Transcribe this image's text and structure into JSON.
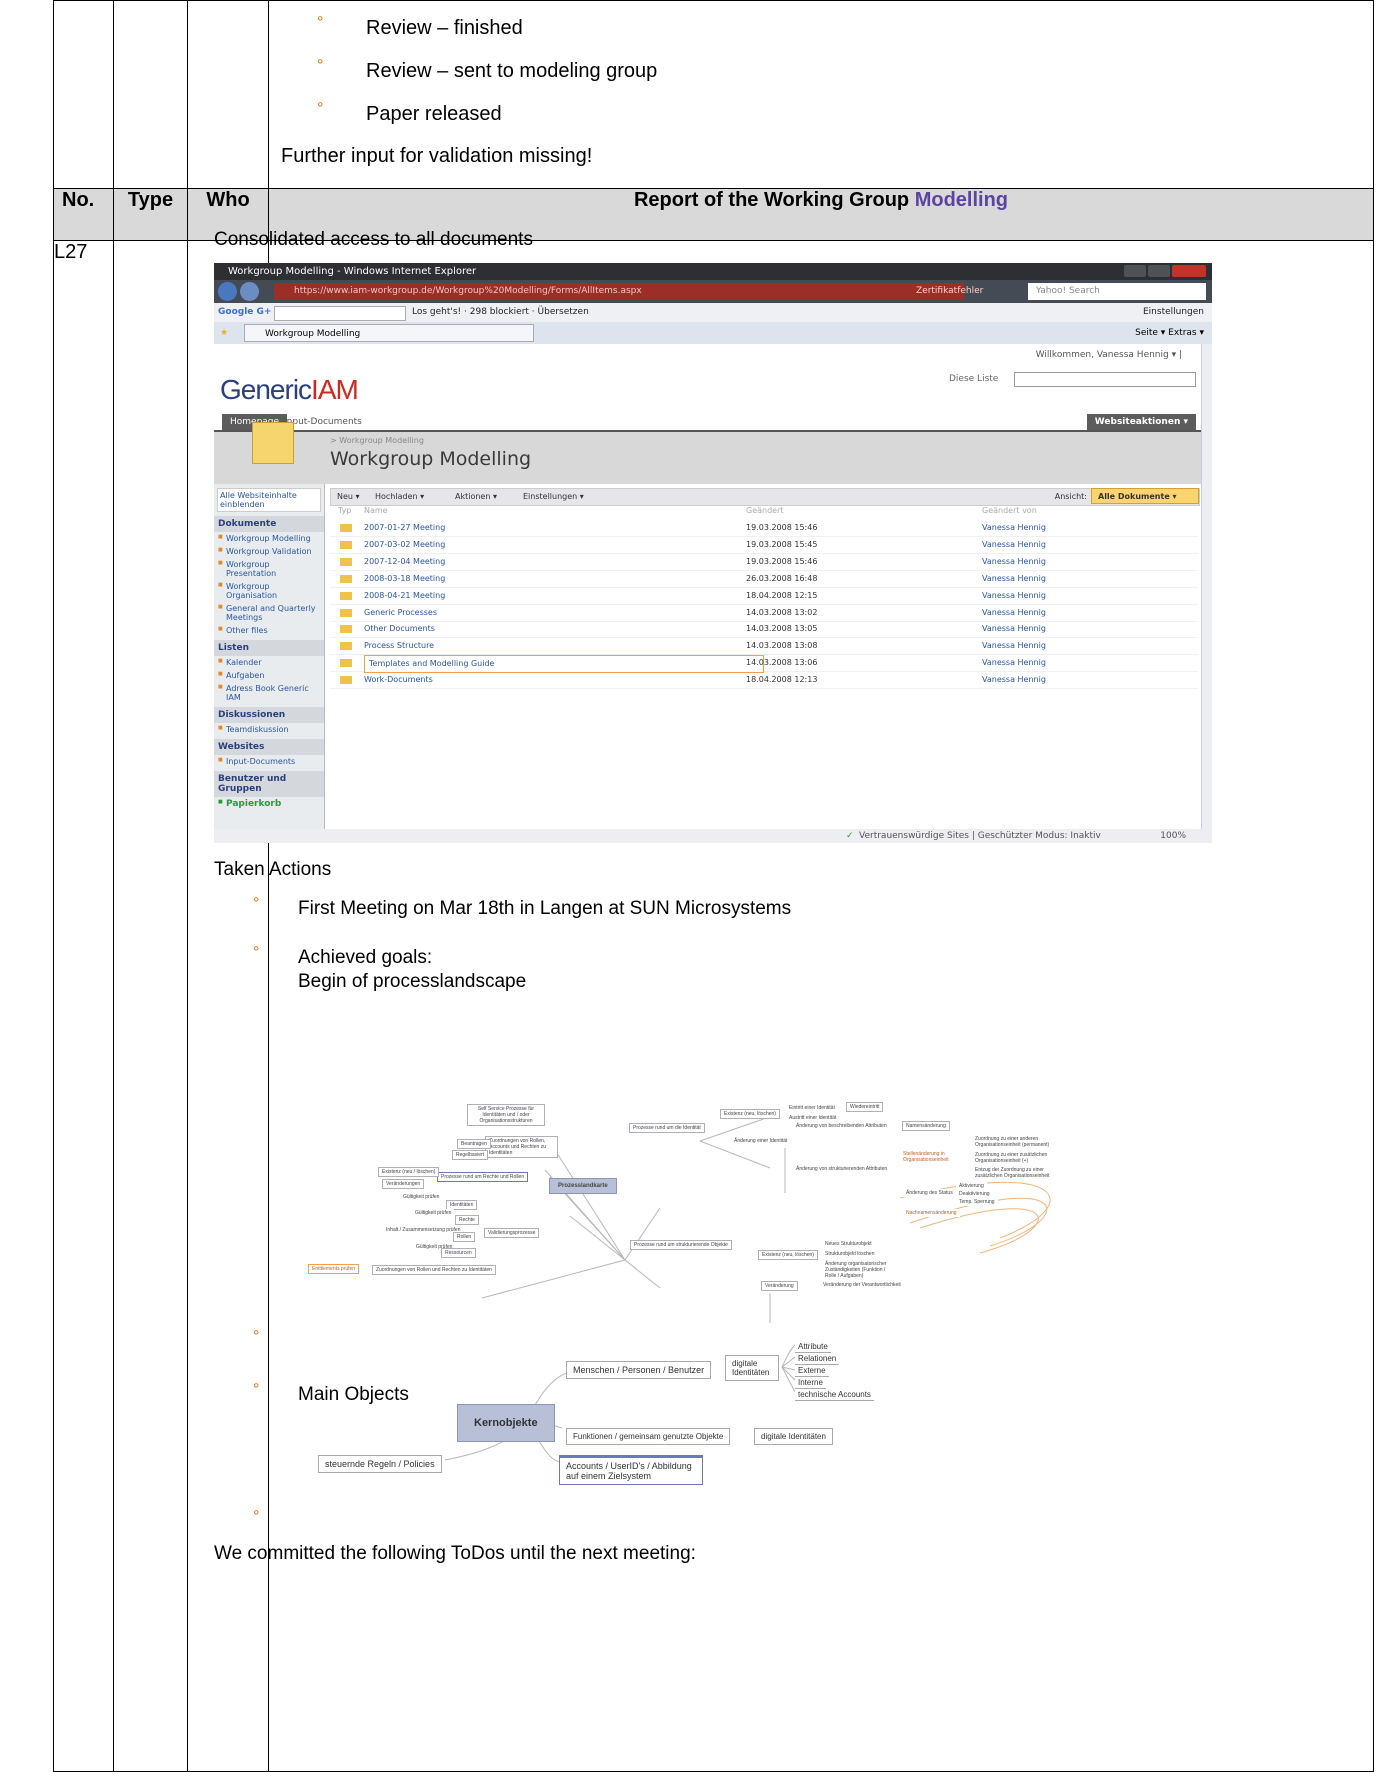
{
  "top_bullets": [
    "Review – finished",
    "Review – sent to modeling group",
    "Paper released"
  ],
  "top_note": "Further input for validation missing!",
  "header": {
    "no": "No.",
    "type": "Type",
    "who": "Who",
    "title_prefix": "Report of the Working Group ",
    "title_accent": "Modelling"
  },
  "accent_color": "#5b44a0",
  "bullet_marker": "°",
  "row": {
    "id": "L27",
    "intro": "Consolidated access to all documents",
    "taken_actions": "Taken Actions",
    "bullets": [
      "First Meeting on Mar 18th in Langen at SUN Microsystems",
      "Achieved goals:",
      "Begin of processlandscape"
    ],
    "main_objects": "Main Objects",
    "todos": "We committed the following ToDos until the next meeting:"
  },
  "browser": {
    "window_title": "Workgroup Modelling - Windows Internet Explorer",
    "url": "https://www.iam-workgroup.de/Workgroup%20Modelling/Forms/AllItems.aspx",
    "cert_warning": "Zertifikatfehler",
    "search_placeholder": "Yahoo! Search",
    "google_label": "Google G+",
    "google_items": "Los geht's! ·  298 blockiert  ·  Übersetzen",
    "settings": "Einstellungen",
    "tab_label": "Workgroup Modelling",
    "tab_tools": "Seite ▾  Extras ▾",
    "welcome": "Willkommen, Vanessa Hennig ▾  |",
    "logo_a": "Generic",
    "logo_b": "IAM",
    "search_scope": "Diese Liste",
    "nav_home": "Homepage",
    "nav_input": "Input-Documents",
    "site_actions": "Websiteaktionen ▾",
    "breadcrumb": "> Workgroup Modelling",
    "page_title": "Workgroup Modelling",
    "left_top": "Alle Websiteinhalte einblenden",
    "left_nav": [
      {
        "heading": "Dokumente",
        "items": [
          "Workgroup Modelling",
          "Workgroup Validation",
          "Workgroup Presentation",
          "Workgroup Organisation",
          "General and Quarterly Meetings",
          "Other files"
        ]
      },
      {
        "heading": "Listen",
        "items": [
          "Kalender",
          "Aufgaben",
          "Adress Book Generic IAM"
        ]
      },
      {
        "heading": "Diskussionen",
        "items": [
          "Teamdiskussion"
        ]
      },
      {
        "heading": "Websites",
        "items": [
          "Input-Documents"
        ]
      },
      {
        "heading": "Benutzer und Gruppen",
        "items": []
      }
    ],
    "papierkorb": "Papierkorb",
    "toolbar": {
      "neu": "Neu ▾",
      "hochladen": "Hochladen ▾",
      "aktionen": "Aktionen ▾",
      "einstellungen": "Einstellungen ▾",
      "ansicht": "Ansicht:",
      "view": "Alle Dokumente ▾"
    },
    "columns": {
      "type": "Typ",
      "name": "Name",
      "modified": "Geändert",
      "modified_by": "Geändert von"
    },
    "files": [
      {
        "name": "2007-01-27 Meeting",
        "modified": "19.03.2008 15:46",
        "by": "Vanessa Hennig"
      },
      {
        "name": "2007-03-02 Meeting",
        "modified": "19.03.2008 15:45",
        "by": "Vanessa Hennig"
      },
      {
        "name": "2007-12-04 Meeting",
        "modified": "19.03.2008 15:46",
        "by": "Vanessa Hennig"
      },
      {
        "name": "2008-03-18 Meeting",
        "modified": "26.03.2008 16:48",
        "by": "Vanessa Hennig"
      },
      {
        "name": "2008-04-21 Meeting",
        "modified": "18.04.2008 12:15",
        "by": "Vanessa Hennig"
      },
      {
        "name": "Generic Processes",
        "modified": "14.03.2008 13:02",
        "by": "Vanessa Hennig"
      },
      {
        "name": "Other Documents",
        "modified": "14.03.2008 13:05",
        "by": "Vanessa Hennig"
      },
      {
        "name": "Process Structure",
        "modified": "14.03.2008 13:08",
        "by": "Vanessa Hennig"
      },
      {
        "name": "Templates and Modelling Guide",
        "modified": "14.03.2008 13:06",
        "by": "Vanessa Hennig"
      },
      {
        "name": "Work-Documents",
        "modified": "18.04.2008 12:13",
        "by": "Vanessa Hennig"
      }
    ],
    "status": "Vertrauenswürdige Sites | Geschützter Modus: Inaktiv",
    "zoom": "100%"
  },
  "mindmap1": {
    "center": "Prozesslandkarte",
    "nodes": [
      "Self Service Prozesse für Identitäten und / oder Organisationsstrukturen",
      "Zuordnungen von Rollen, Accounts und Rechten zu Identitäten",
      "Beantragen",
      "Regelbasiert",
      "Prozesse rund um Rechte und Rollen",
      "Existenz (neu / löschen)",
      "Veränderungen",
      "Validierungsprozesse",
      "Gültigkeit prüfen",
      "Identitäten",
      "Gültigkeit prüfen",
      "Rechte",
      "Inhalt / Zusammensetzung prüfen",
      "Rollen",
      "Gültigkeit prüfen",
      "Ressourcen",
      "Zuordnungen von Rollen und Rechten zu Identitäten",
      "Entitlements prüfen",
      "Prozesse rund um die Identität",
      "Existenz (neu, löschen)",
      "Eintritt einer Identität",
      "Wiedereintritt",
      "Austritt einer Identität",
      "Änderung einer Identität",
      "Änderung von beschreibenden Attributen",
      "Namensänderung",
      "Änderung von strukturierenden Attributen",
      "Stellenänderung in Organisationseinheit",
      "Zuordnung zu einer anderen Organisationseinheit (permanent)",
      "Zuordnung zu einer zusätzlichen Organisationseinheit (+)",
      "Entzug der Zuordnung zu einer zusätzlichen Organisationseinheit",
      "Änderung des Status",
      "Aktivierung",
      "Deaktivierung",
      "Temp. Sperrung",
      "Nachnamensänderung",
      "Prozesse rund um strukturierende Objekte",
      "Existenz (neu, löschen)",
      "Neues Strukturobjekt",
      "Strukturobjekt löschen",
      "Änderung organisatorischer Zuständigkeiten (Funktion / Rolle / Aufgaben)",
      "Veränderung",
      "Veränderung der Verantwortlichkeit"
    ]
  },
  "mindmap2": {
    "center": "Kernobjekte",
    "nodes": [
      "Menschen / Personen / Benutzer",
      "digitale Identitäten",
      "Attribute",
      "Relationen",
      "Externe",
      "Interne",
      "technische Accounts",
      "Funktionen / gemeinsam genutzte Objekte",
      "digitale Identitäten",
      "steuernde Regeln / Policies",
      "Accounts / UserID's / Abbildung auf einem Zielsystem"
    ]
  }
}
